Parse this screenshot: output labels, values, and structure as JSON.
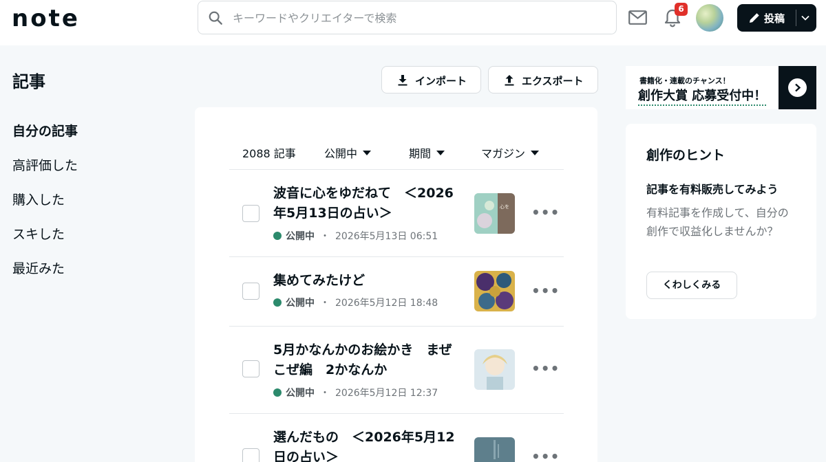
{
  "header": {
    "logo": "note",
    "search_placeholder": "キーワードやクリエイターで検索",
    "notification_count": "6",
    "post_label": "投稿"
  },
  "sidebar": {
    "title": "記事",
    "items": [
      {
        "label": "自分の記事",
        "active": true
      },
      {
        "label": "高評価した",
        "active": false
      },
      {
        "label": "購入した",
        "active": false
      },
      {
        "label": "スキした",
        "active": false
      },
      {
        "label": "最近みた",
        "active": false
      }
    ]
  },
  "actions": {
    "import_label": "インポート",
    "export_label": "エクスポート"
  },
  "filters": {
    "count": "2088 記事",
    "status": "公開中",
    "period": "期間",
    "magazine": "マガジン"
  },
  "articles": [
    {
      "title": "波音に心をゆだねて　＜2026年5月13日の占い＞",
      "status": "公開中",
      "date": "2026年5月13日 06:51"
    },
    {
      "title": "集めてみたけど",
      "status": "公開中",
      "date": "2026年5月12日 18:48"
    },
    {
      "title": "5月かなんかのお絵かき　まぜこぜ編　2かなんか",
      "status": "公開中",
      "date": "2026年5月12日 12:37"
    },
    {
      "title": "選んだもの　＜2026年5月12日の占い＞",
      "status": "",
      "date": ""
    }
  ],
  "banner": {
    "line1": "書籍化・連載のチャンス！",
    "line2": "創作大賞 応募受付中！"
  },
  "hint": {
    "title": "創作のヒント",
    "subtitle": "記事を有料販売してみよう",
    "body": "有料記事を作成して、自分の創作で収益化しませんか？",
    "button": "くわしくみる"
  },
  "colors": {
    "accent": "#2c8a6c",
    "dark": "#08131a",
    "badge": "#e0302a"
  }
}
